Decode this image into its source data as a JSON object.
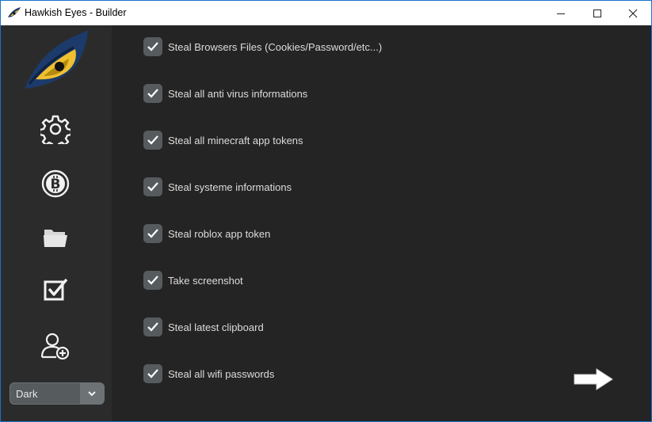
{
  "window": {
    "title": "Hawkish Eyes - Builder",
    "border_color": "#1a73c9"
  },
  "sidebar": {
    "logo": "eye-logo",
    "icons": [
      {
        "name": "gear-icon"
      },
      {
        "name": "bitcoin-icon"
      },
      {
        "name": "folder-icon"
      },
      {
        "name": "checkbox-icon"
      },
      {
        "name": "add-user-icon"
      }
    ],
    "theme": {
      "selected": "Dark"
    }
  },
  "options": [
    {
      "label": "Steal Browsers Files (Cookies/Password/etc...)",
      "checked": true
    },
    {
      "label": "Steal all anti virus informations",
      "checked": true
    },
    {
      "label": "Steal all minecraft app tokens",
      "checked": true
    },
    {
      "label": "Steal systeme informations",
      "checked": true
    },
    {
      "label": "Steal roblox app token",
      "checked": true
    },
    {
      "label": "Take screenshot",
      "checked": true
    },
    {
      "label": "Steal latest clipboard",
      "checked": true
    },
    {
      "label": "Steal all wifi passwords",
      "checked": true
    }
  ],
  "colors": {
    "background": "#242424",
    "sidebar": "#2b2b2b",
    "checkbox": "#565b5e",
    "logo_accent": "#f0c030",
    "logo_dark": "#1c3a6a"
  }
}
